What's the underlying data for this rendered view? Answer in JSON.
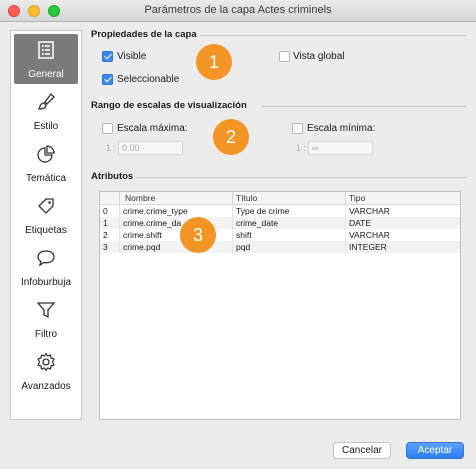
{
  "window": {
    "title": "Parámetros de la capa Actes criminels"
  },
  "sidebar": {
    "items": [
      {
        "label": "General",
        "icon": "general-icon",
        "active": true
      },
      {
        "label": "Estilo",
        "icon": "paintbrush-icon",
        "active": false
      },
      {
        "label": "Temática",
        "icon": "pie-chart-icon",
        "active": false
      },
      {
        "label": "Etiquetas",
        "icon": "tag-icon",
        "active": false
      },
      {
        "label": "Infoburbuja",
        "icon": "speech-bubble-icon",
        "active": false
      },
      {
        "label": "Filtro",
        "icon": "funnel-icon",
        "active": false
      },
      {
        "label": "Avanzados",
        "icon": "gear-icon",
        "active": false
      }
    ]
  },
  "properties": {
    "title": "Propiedades de la capa",
    "visible_label": "Visible",
    "visible_checked": true,
    "selectable_label": "Seleccionable",
    "selectable_checked": true,
    "global_view_label": "Vista global",
    "global_view_checked": false
  },
  "scale_range": {
    "title": "Rango de escalas de visualización",
    "max_label": "Escala máxima:",
    "max_checked": false,
    "max_prefix": "1 :",
    "max_value": "0.00",
    "min_label": "Escala mínima:",
    "min_checked": false,
    "min_prefix": "1 :",
    "min_value": "∞"
  },
  "attributes": {
    "title": "Atributos",
    "columns": [
      "",
      "Nombre",
      "Título",
      "Tipo"
    ],
    "rows": [
      [
        "0",
        "crime.crime_type",
        "Type de crime",
        "VARCHAR"
      ],
      [
        "1",
        "crime.crime_da",
        "crime_date",
        "DATE"
      ],
      [
        "2",
        "crime.shift",
        "shift",
        "VARCHAR"
      ],
      [
        "3",
        "crime.pqd",
        "pqd",
        "INTEGER"
      ]
    ]
  },
  "badges": [
    "1",
    "2",
    "3"
  ],
  "footer": {
    "cancel_label": "Cancelar",
    "accept_label": "Aceptar"
  },
  "colors": {
    "accent": "#3b87f6",
    "badge": "#f29524",
    "active_sidebar": "#7b7b7b"
  }
}
